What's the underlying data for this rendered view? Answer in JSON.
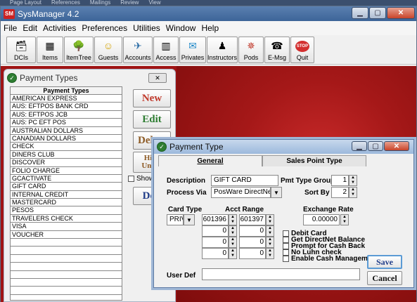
{
  "background_menu": [
    "Page Layout",
    "References",
    "Mailings",
    "Review",
    "View"
  ],
  "app": {
    "title": "SysManager 4.2",
    "logo_text": "SM"
  },
  "menu": [
    "File",
    "Edit",
    "Activities",
    "Preferences",
    "Utilities",
    "Window",
    "Help"
  ],
  "toolbar": [
    {
      "label": "DCIs",
      "icon": "🗃"
    },
    {
      "label": "Items",
      "icon": "▦"
    },
    {
      "label": "ItemTree",
      "icon": "🌳"
    },
    {
      "label": "Guests",
      "icon": "☺"
    },
    {
      "label": "Accounts",
      "icon": "✈"
    },
    {
      "label": "Access",
      "icon": "▥"
    },
    {
      "label": "Privates",
      "icon": "✉"
    },
    {
      "label": "Instructors",
      "icon": "♟"
    },
    {
      "label": "Pods",
      "icon": "✵"
    },
    {
      "label": "E-Msg",
      "icon": "☎"
    },
    {
      "label": "Quit",
      "icon": "STOP"
    }
  ],
  "payment_types_panel": {
    "title": "Payment Types",
    "column_header": "Payment Types",
    "items": [
      "AMERICAN EXPRESS",
      "AUS: EFTPOS BANK CRD",
      "AUS: EFTPOS JCB",
      "AUS: PC EFT POS",
      "AUSTRALIAN DOLLARS",
      "CANADIAN DOLLARS",
      "CHECK",
      "DINERS CLUB",
      "DISCOVER",
      "FOLIO CHARGE",
      "GCACTIVATE",
      "GIFT CARD",
      "INTERNAL CREDIT",
      "MASTERCARD",
      "PESOS",
      "TRAVELERS CHECK",
      "VISA",
      "VOUCHER",
      "",
      "",
      "",
      "",
      "",
      "",
      "",
      ""
    ],
    "buttons": {
      "new": "New",
      "edit": "Edit",
      "delete": "Delete",
      "hide": "Hide Unhid",
      "done": "Don"
    },
    "show_hidden_label": "Show h"
  },
  "dialog": {
    "title": "Payment Type",
    "tabs": [
      "General",
      "Sales Point Type"
    ],
    "description_label": "Description",
    "description_value": "GIFT CARD",
    "process_via_label": "Process Via",
    "process_via_value": "PosWare DirectNet",
    "pmt_type_group_label": "Pmt Type Group",
    "pmt_type_group_value": "1",
    "sort_by_label": "Sort By",
    "sort_by_value": "2",
    "card_type_label": "Card Type",
    "card_type_value": "PRIV",
    "acct_range_label": "Acct Range",
    "acct_range_rows": [
      [
        "601396",
        "601397"
      ],
      [
        "0",
        "0"
      ],
      [
        "0",
        "0"
      ],
      [
        "0",
        "0"
      ]
    ],
    "exchange_rate_label": "Exchange Rate",
    "exchange_rate_value": "0.00000",
    "checkboxes": [
      "Debit Card",
      "Get DirectNet Balance",
      "Prompt for Cash Back",
      "No Luhn check",
      "Enable Cash Management"
    ],
    "user_def_label": "User Def",
    "user_def_value": "",
    "save_label": "Save",
    "cancel_label": "Cancel"
  },
  "colors": {
    "desktop": "#a01414",
    "accent": "#5b9bd5",
    "new": "#c0392b",
    "edit": "#2e7d32",
    "delete": "#8d5a24"
  }
}
